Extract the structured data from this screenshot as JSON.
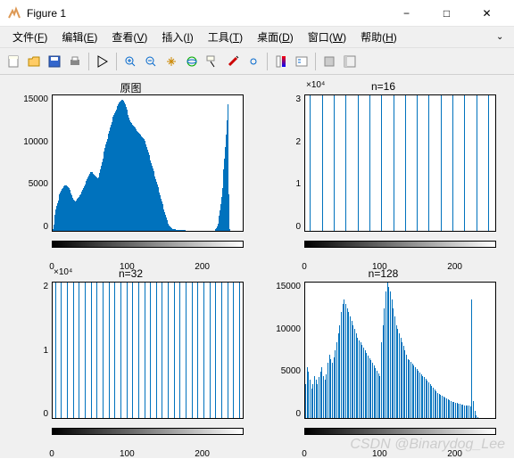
{
  "window": {
    "title": "Figure 1",
    "minimize": "−",
    "maximize": "□",
    "close": "✕"
  },
  "menu": {
    "items": [
      {
        "label": "文件",
        "accel": "F"
      },
      {
        "label": "编辑",
        "accel": "E"
      },
      {
        "label": "查看",
        "accel": "V"
      },
      {
        "label": "插入",
        "accel": "I"
      },
      {
        "label": "工具",
        "accel": "T"
      },
      {
        "label": "桌面",
        "accel": "D"
      },
      {
        "label": "窗口",
        "accel": "W"
      },
      {
        "label": "帮助",
        "accel": "H"
      }
    ],
    "dock": "⌄"
  },
  "toolbar": {
    "icons": [
      "new",
      "open",
      "save",
      "print",
      "arrow",
      "zoom-in",
      "zoom-out",
      "pan",
      "rotate",
      "datacursor",
      "brush",
      "link",
      "colorbar",
      "legend",
      "small-window",
      "reset-view"
    ]
  },
  "chart_data": [
    {
      "title": "原图",
      "type": "bar",
      "x_range": [
        0,
        255
      ],
      "x_ticks": [
        "0",
        "100",
        "200"
      ],
      "y_ticks": [
        "0",
        "5000",
        "10000",
        "15000"
      ],
      "y_max": 15000,
      "values_shape": "dense-histogram",
      "approx_values_256": [
        200,
        700,
        1200,
        1800,
        2400,
        2800,
        3100,
        3400,
        3700,
        4000,
        4200,
        4400,
        4600,
        4700,
        4800,
        4900,
        5000,
        5000,
        5000,
        4900,
        4800,
        4700,
        4500,
        4300,
        4100,
        3900,
        3700,
        3500,
        3400,
        3300,
        3300,
        3400,
        3500,
        3600,
        3700,
        3800,
        3900,
        4000,
        4100,
        4300,
        4500,
        4700,
        4900,
        5100,
        5300,
        5500,
        5700,
        5900,
        6100,
        6300,
        6400,
        6500,
        6500,
        6400,
        6300,
        6200,
        6100,
        6000,
        5900,
        5800,
        5800,
        5900,
        6100,
        6400,
        6800,
        7200,
        7600,
        8000,
        8400,
        8800,
        9200,
        9600,
        9900,
        10200,
        10500,
        10800,
        11100,
        11400,
        11700,
        12000,
        12300,
        12600,
        12800,
        13000,
        13200,
        13400,
        13600,
        13800,
        14000,
        14200,
        14300,
        14400,
        14500,
        14500,
        14500,
        14400,
        14200,
        14000,
        13700,
        13400,
        13100,
        12800,
        12500,
        12200,
        12000,
        11900,
        11800,
        11700,
        11600,
        11500,
        11400,
        11300,
        11200,
        11100,
        11000,
        10900,
        10800,
        10700,
        10600,
        10500,
        10400,
        10300,
        10200,
        10000,
        9800,
        9600,
        9300,
        9000,
        8700,
        8400,
        8100,
        7800,
        7500,
        7200,
        6900,
        6600,
        6300,
        6000,
        5700,
        5400,
        5100,
        4800,
        4500,
        4200,
        3900,
        3600,
        3300,
        3000,
        2700,
        2400,
        2100,
        1800,
        1500,
        1200,
        1000,
        800,
        600,
        500,
        400,
        300,
        250,
        200,
        180,
        160,
        150,
        140,
        130,
        120,
        110,
        100,
        95,
        90,
        85,
        80,
        75,
        70,
        65,
        60,
        55,
        50,
        48,
        46,
        44,
        42,
        40,
        38,
        36,
        34,
        32,
        30,
        28,
        26,
        25,
        24,
        23,
        22,
        21,
        20,
        19,
        18,
        17,
        16,
        15,
        14,
        13,
        12,
        12,
        11,
        11,
        10,
        10,
        9,
        9,
        8,
        8,
        8,
        7,
        7,
        7,
        150,
        300,
        500,
        800,
        1200,
        1700,
        2300,
        3000,
        3800,
        4700,
        5700,
        6800,
        8000,
        9300,
        10700,
        12200,
        14000,
        4000,
        1000,
        200,
        50,
        10,
        0,
        0,
        0,
        0,
        0,
        0,
        0,
        0,
        0,
        0,
        0,
        0,
        0,
        0
      ]
    },
    {
      "title": "n=16",
      "exponent": "×10⁴",
      "type": "bar",
      "x_range": [
        0,
        255
      ],
      "x_ticks": [
        "0",
        "100",
        "200"
      ],
      "y_ticks": [
        "0",
        "1",
        "2",
        "3"
      ],
      "y_max": 3.6,
      "n_bins": 16,
      "values": [
        3.6,
        3.6,
        3.6,
        3.6,
        3.6,
        3.6,
        3.6,
        3.6,
        3.6,
        3.6,
        3.6,
        3.6,
        3.6,
        3.6,
        3.6,
        3.6
      ]
    },
    {
      "title": "n=32",
      "exponent": "×10⁴",
      "type": "bar",
      "x_range": [
        0,
        255
      ],
      "x_ticks": [
        "0",
        "100",
        "200"
      ],
      "y_ticks": [
        "0",
        "1",
        "2"
      ],
      "y_max": 2.5,
      "n_bins": 32,
      "values": [
        2.5,
        2.5,
        2.5,
        2.5,
        2.5,
        2.5,
        2.5,
        2.5,
        2.5,
        2.5,
        2.5,
        2.5,
        2.5,
        2.5,
        2.5,
        2.5,
        2.5,
        2.5,
        2.5,
        2.5,
        2.5,
        2.5,
        2.5,
        2.5,
        2.5,
        2.5,
        2.5,
        2.5,
        2.5,
        2.5,
        2.5,
        2.5
      ]
    },
    {
      "title": "n=128",
      "type": "bar",
      "x_range": [
        0,
        255
      ],
      "x_ticks": [
        "0",
        "100",
        "200"
      ],
      "y_ticks": [
        "0",
        "5000",
        "10000",
        "15000"
      ],
      "y_max": 16000,
      "n_bins": 128,
      "approx_values_128": [
        4000,
        6000,
        5500,
        4500,
        3500,
        4000,
        5000,
        4500,
        4000,
        4800,
        5500,
        6000,
        5000,
        4500,
        5200,
        6500,
        7500,
        7000,
        6500,
        7200,
        8000,
        9000,
        10000,
        11000,
        12500,
        13500,
        14000,
        13500,
        13000,
        12500,
        12000,
        11500,
        11000,
        10500,
        10000,
        9500,
        9200,
        8900,
        8600,
        8300,
        8000,
        7700,
        7400,
        7100,
        6800,
        6500,
        6200,
        5900,
        5600,
        5300,
        5000,
        9000,
        11000,
        13000,
        15000,
        16000,
        15500,
        15000,
        14000,
        13000,
        12000,
        11000,
        10500,
        10000,
        9500,
        9000,
        8500,
        8000,
        7500,
        7000,
        6800,
        6600,
        6400,
        6200,
        6000,
        5800,
        5600,
        5400,
        5200,
        5000,
        4800,
        4600,
        4400,
        4200,
        4000,
        3800,
        3600,
        3400,
        3200,
        3000,
        2800,
        2700,
        2600,
        2500,
        2400,
        2300,
        2200,
        2100,
        2000,
        1900,
        1850,
        1800,
        1750,
        1700,
        1650,
        1600,
        1550,
        1500,
        1480,
        1460,
        1440,
        1420,
        14000,
        2000,
        800,
        300,
        100,
        50,
        20,
        10,
        5,
        0,
        0,
        0,
        0,
        0,
        0,
        0
      ]
    }
  ],
  "watermark": "CSDN @Binarydog_Lee"
}
